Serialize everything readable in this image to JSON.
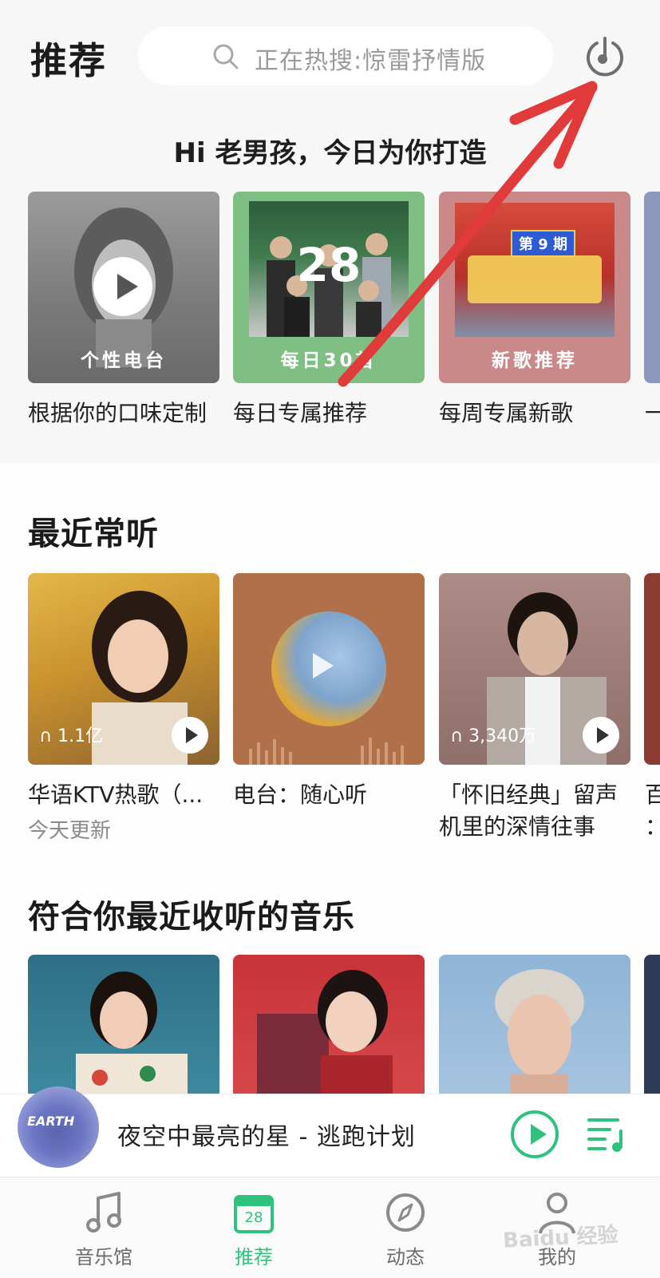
{
  "header": {
    "title": "推荐",
    "search_placeholder": "正在热搜:惊雷抒情版"
  },
  "greeting": "Hi 老男孩，今日为你打造",
  "daily_cards": [
    {
      "caption": "个性电台",
      "subtitle": "根据你的口味定制"
    },
    {
      "caption": "每日30首",
      "date_number": "28",
      "subtitle": "每日专属推荐"
    },
    {
      "caption": "新歌推荐",
      "badge": "第 9 期",
      "subtitle": "每周专属新歌"
    },
    {
      "subtitle": "一"
    }
  ],
  "recent": {
    "title": "最近常听",
    "items": [
      {
        "title": "华语KTV热歌（...",
        "plays": "1.1亿",
        "meta": "今天更新"
      },
      {
        "title": "电台：随心听"
      },
      {
        "title_line1": "「怀旧经典」留声",
        "title_line2": "机里的深情往事",
        "plays": "3,340万"
      },
      {
        "title_line1": "百",
        "title_line2": "："
      }
    ]
  },
  "recommended": {
    "title": "符合你最近收听的音乐"
  },
  "mini_player": {
    "now_playing": "夜空中最亮的星 - 逃跑计划",
    "cover_text": "EARTH"
  },
  "tabs": [
    {
      "label": "音乐馆",
      "icon": "music-note-icon",
      "active": false
    },
    {
      "label": "推荐",
      "icon": "calendar-icon",
      "icon_text": "28",
      "active": true
    },
    {
      "label": "动态",
      "icon": "compass-icon",
      "active": false
    },
    {
      "label": "我的",
      "icon": "user-icon",
      "active": false
    }
  ],
  "watermark": "Baidu 经验",
  "colors": {
    "accent": "#2ec27e",
    "annotation_arrow": "#e03a3a"
  }
}
